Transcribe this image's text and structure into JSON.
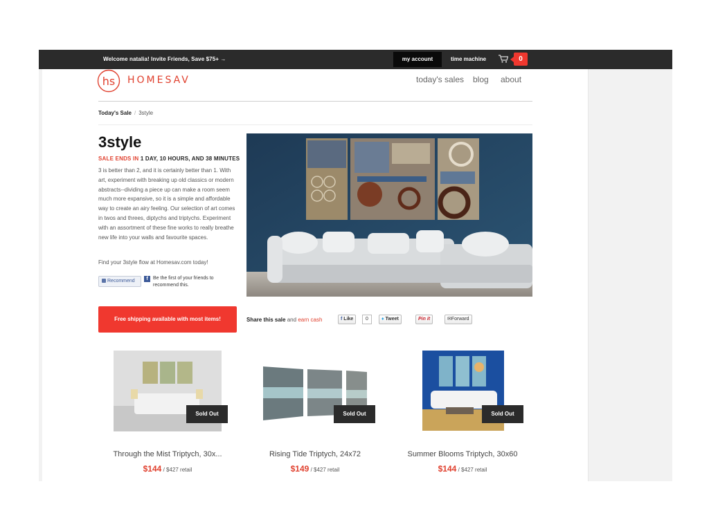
{
  "topbar": {
    "welcome": "Welcome natalia! Invite Friends, Save $75+ →",
    "my_account": "my account",
    "time_machine": "time machine",
    "cart_count": "0"
  },
  "header": {
    "logo_mark": "hs",
    "brand": "HOMESAV",
    "nav": [
      "today's sales",
      "blog",
      "about"
    ]
  },
  "breadcrumb": [
    "Today's Sale",
    "/",
    "3style"
  ],
  "sale": {
    "title": "3style",
    "ends_label": "SALE ENDS IN",
    "ends_value": "1 DAY, 10 HOURS, AND 38 MINUTES",
    "description": "3 is better than 2, and it is certainly better than 1. With art, experiment with breaking up old classics or modern abstracts--dividing a piece up can make a room seem much more expansive, so it is a simple and affordable way to create an airy feeling. Our selection of art comes in twos and threes, diptychs and triptychs. Experiment with an assortment of these fine works to really breathe new life into your walls and favourite spaces.",
    "find_text": "Find your 3style flow at Homesav.com today!",
    "recommend_label": "Recommend",
    "recommend_text": "Be the first of your friends to recommend this."
  },
  "shipping_banner": "Free shipping available with most items!",
  "share": {
    "label": "Share this sale",
    "and": "and",
    "earn": "earn cash",
    "like_label": "Like",
    "like_count": "0",
    "tweet_label": "Tweet",
    "pin_label": "Pin it",
    "forward_label": "Forward"
  },
  "products": [
    {
      "name": "Through the Mist Triptych, 30x...",
      "price": "$144",
      "retail": "/ $427 retail",
      "status": "Sold Out"
    },
    {
      "name": "Rising Tide Triptych, 24x72",
      "price": "$149",
      "retail": "/ $427 retail",
      "status": "Sold Out"
    },
    {
      "name": "Summer Blooms Triptych, 30x60",
      "price": "$144",
      "retail": "/ $427 retail",
      "status": "Sold Out"
    }
  ],
  "colors": {
    "accent": "#f0382f",
    "topbar": "#2b2b2b",
    "brand": "#e0402e"
  },
  "icons": [
    "cart-icon",
    "logo-icon",
    "facebook-icon",
    "twitter-icon",
    "pinterest-icon",
    "email-icon"
  ]
}
